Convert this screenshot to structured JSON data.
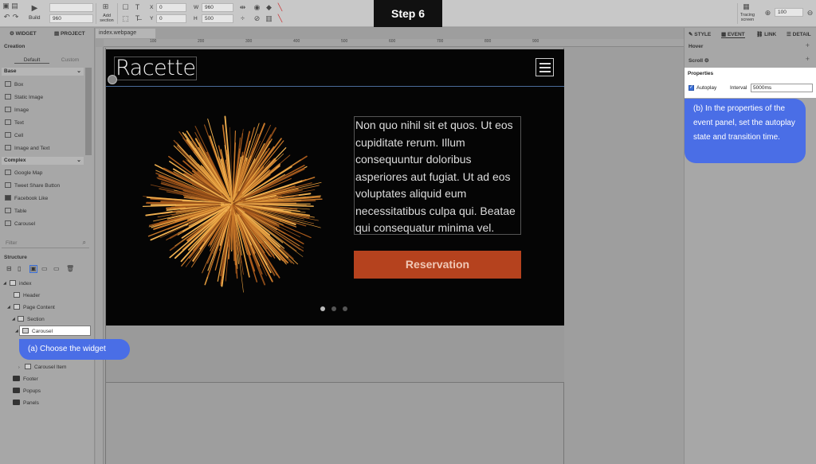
{
  "toolbar": {
    "build_label": "Build",
    "width_preset": "960",
    "add_section_label": "Add section",
    "x_label": "X",
    "x_value": "0",
    "y_label": "Y",
    "y_value": "0",
    "w_label": "W",
    "w_value": "960",
    "h_label": "H",
    "h_value": "500",
    "tracing_label": "Tracing screen",
    "zoom_value": "100"
  },
  "banner": {
    "title": "Step 6"
  },
  "left_panel": {
    "tab_widget": "WIDGET",
    "tab_project": "PROJECT",
    "creation_label": "Creation",
    "tab_default": "Default",
    "tab_custom": "Custom",
    "base_label": "Base",
    "base_items": [
      "Box",
      "Static Image",
      "Image",
      "Text",
      "Cell",
      "Image and Text"
    ],
    "complex_label": "Complex",
    "complex_items": [
      "Google Map",
      "Tweet Share Button",
      "Facebook Like",
      "Table",
      "Carousel"
    ],
    "filter_placeholder": "Filter",
    "structure_label": "Structure",
    "tree": {
      "index": "index",
      "header": "Header",
      "page_content": "Page Content",
      "section": "Section",
      "carousel": "Carousel",
      "carousel_item": "Carousel Item",
      "footer": "Footer",
      "popups": "Popups",
      "panels": "Panels"
    }
  },
  "canvas": {
    "doc_tab": "index.webpage",
    "ruler_labels": [
      "100",
      "200",
      "300",
      "400",
      "500",
      "600",
      "700",
      "800",
      "900"
    ],
    "logo_text": "Racette",
    "hero_text": "Non quo nihil sit et quos. Ut eos cupiditate rerum. Illum consequuntur doloribus asperiores aut fugiat. Ut ad eos voluptates aliquid eum necessitatibus culpa qui. Beatae qui consequatur minima vel.",
    "button_label": "Reservation",
    "slides_total": 3,
    "active_slide": 1
  },
  "right_panel": {
    "tab_style": "STYLE",
    "tab_event": "EVENT",
    "tab_link": "LINK",
    "tab_detail": "DETAIL",
    "hover_label": "Hover",
    "scroll_label": "Scroll",
    "properties_label": "Properties",
    "autoplay_label": "Autoplay",
    "autoplay_checked": true,
    "interval_label": "Interval",
    "interval_value": "5000ms"
  },
  "callouts": {
    "a": "(a) Choose the widget",
    "b": "(b) In the properties of the event panel, set the autoplay state and transition time."
  },
  "colors": {
    "callout_blue": "#4a6ee6",
    "button_orange": "#b5421e",
    "hero_bg": "#050505"
  }
}
